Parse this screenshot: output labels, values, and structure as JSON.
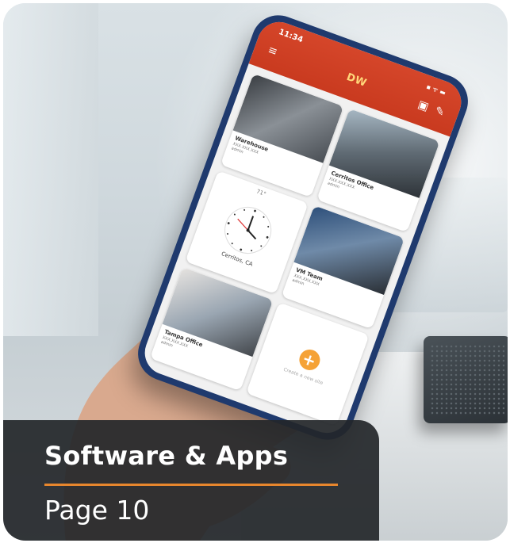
{
  "phone": {
    "status_time": "11:34",
    "status_icons": "▪︎ ᯤ ▬",
    "app_logo": "DW",
    "tiles": [
      {
        "title": "Warehouse",
        "sub": "XXX.XXX.XXX",
        "sub2": "admin"
      },
      {
        "title": "Cerritos Office",
        "sub": "XXX.XXX.XXX",
        "sub2": "admin"
      },
      {
        "title": "VM Team",
        "sub": "XXX.XXX.XXX",
        "sub2": "admin"
      },
      {
        "title": "Tampa Office",
        "sub": "XXX.XXX.XXX",
        "sub2": "admin"
      }
    ],
    "clock": {
      "weather": "71°",
      "city": "Cerritos, CA"
    },
    "add_label": "Create a new site"
  },
  "banner": {
    "title": "Software & Apps",
    "subtitle": "Page 10"
  },
  "colors": {
    "accent": "#e7862d",
    "appbar": "#c93a1f",
    "banner_bg": "#232629",
    "add_button": "#f5a236"
  }
}
